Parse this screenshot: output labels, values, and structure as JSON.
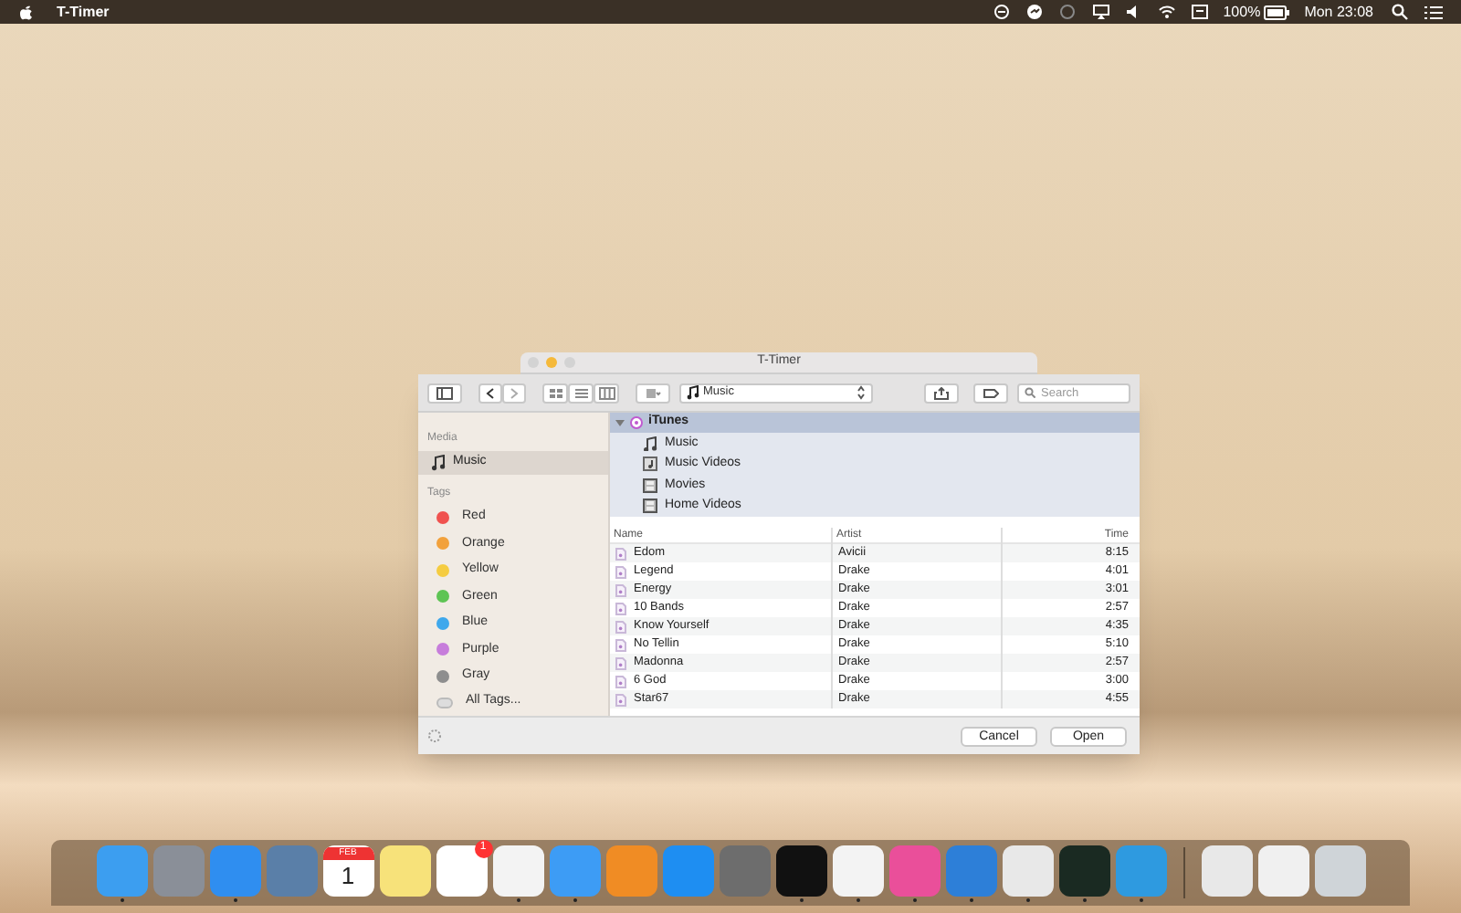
{
  "menu_bar": {
    "app_name": "T-Timer",
    "battery": "100%",
    "clock": "Mon 23:08"
  },
  "back_window": {
    "title": "T-Timer"
  },
  "dialog": {
    "location": "Music",
    "search": {
      "placeholder": "Search"
    },
    "sidebar": {
      "sections": [
        {
          "heading": "Media",
          "items": [
            {
              "label": "Music",
              "selected": true
            }
          ]
        }
      ],
      "tags_heading": "Tags",
      "tags": [
        {
          "label": "Red",
          "color": "#f0524f"
        },
        {
          "label": "Orange",
          "color": "#f2a13c"
        },
        {
          "label": "Yellow",
          "color": "#f5cc41"
        },
        {
          "label": "Green",
          "color": "#5ec454"
        },
        {
          "label": "Blue",
          "color": "#3fa8ec"
        },
        {
          "label": "Purple",
          "color": "#c77ddb"
        },
        {
          "label": "Gray",
          "color": "#8e8e8e"
        }
      ],
      "all_tags": "All Tags..."
    },
    "tree": {
      "label": "iTunes",
      "expanded": true,
      "children": [
        {
          "label": "Music",
          "kind": "music"
        },
        {
          "label": "Music Videos",
          "kind": "video"
        },
        {
          "label": "Movies",
          "kind": "film"
        },
        {
          "label": "Home Videos",
          "kind": "film"
        }
      ]
    },
    "table": {
      "columns": [
        "Name",
        "Artist",
        "Time"
      ],
      "rows": [
        [
          "Edom",
          "Avicii",
          "8:15"
        ],
        [
          "Legend",
          "Drake",
          "4:01"
        ],
        [
          "Energy",
          "Drake",
          "3:01"
        ],
        [
          "10 Bands",
          "Drake",
          "2:57"
        ],
        [
          "Know Yourself",
          "Drake",
          "4:35"
        ],
        [
          "No Tellin",
          "Drake",
          "5:10"
        ],
        [
          "Madonna",
          "Drake",
          "2:57"
        ],
        [
          "6 God",
          "Drake",
          "3:00"
        ],
        [
          "Star67",
          "Drake",
          "4:55"
        ]
      ]
    },
    "buttons": [
      {
        "label": "Cancel",
        "default": false
      },
      {
        "label": "Open",
        "default": false
      }
    ]
  },
  "dock": {
    "items": [
      {
        "running": true
      },
      {
        "running": false
      },
      {
        "running": true
      },
      {
        "running": false
      },
      {
        "running": false,
        "month": "FEB",
        "day": "1"
      },
      {
        "running": false
      },
      {
        "running": false,
        "badge": "1"
      },
      {
        "running": true
      },
      {
        "running": true
      },
      {
        "running": false
      },
      {
        "running": false
      },
      {
        "running": false
      },
      {
        "running": true
      },
      {
        "running": true
      },
      {
        "running": true
      },
      {
        "running": true
      },
      {
        "running": true
      },
      {
        "running": true
      },
      {
        "running": true
      },
      {
        "running": false
      },
      {
        "running": false
      },
      {
        "running": false
      }
    ]
  }
}
